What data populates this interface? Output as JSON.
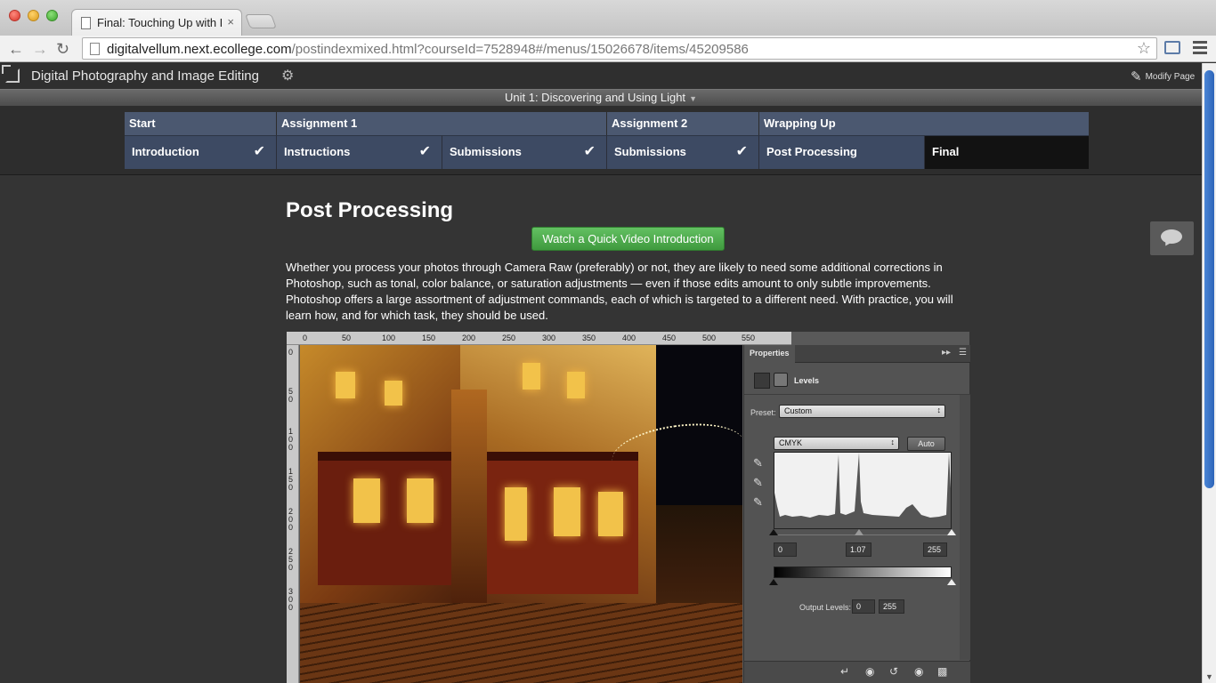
{
  "browser": {
    "tab_title": "Final: Touching Up with Le",
    "tab_close": "×",
    "url_host": "digitalvellum.next.ecollege.com",
    "url_path": "/postindexmixed.html?courseId=7528948#/menus/15026678/items/45209586"
  },
  "header": {
    "course_title": "Digital Photography and Image Editing",
    "modify_label": "Modify Page",
    "unit_title": "Unit 1: Discovering and Using Light"
  },
  "progress": {
    "phases": [
      {
        "label": "Start"
      },
      {
        "label": "Assignment 1"
      },
      {
        "label": "Assignment 2"
      },
      {
        "label": "Wrapping Up"
      }
    ],
    "steps": [
      {
        "label": "Introduction",
        "completed": true
      },
      {
        "label": "Instructions",
        "completed": true
      },
      {
        "label": "Submissions",
        "completed": true
      },
      {
        "label": "Submissions",
        "completed": true
      },
      {
        "label": "Post Processing",
        "completed": false
      },
      {
        "label": "Final",
        "completed": false,
        "active": true
      }
    ]
  },
  "content": {
    "title": "Post Processing",
    "video_button": "Watch a Quick Video Introduction",
    "body": "Whether you process your photos through Camera Raw (preferably) or not, they are likely to need some additional corrections in Photoshop, such as tonal, color balance, or saturation adjustments — even if those edits amount to only subtle improvements. Photoshop offers a large assortment of adjustment commands, each of which is targeted to a different need. With practice, you will learn how, and for which task, they should be used."
  },
  "photoshop": {
    "ruler_top": [
      "0",
      "50",
      "100",
      "150",
      "200",
      "250",
      "300",
      "350",
      "400",
      "450",
      "500",
      "550"
    ],
    "ruler_left": [
      "0",
      "50",
      "100",
      "150",
      "200",
      "250",
      "300"
    ],
    "panel_tab": "Properties",
    "adjustment_title": "Levels",
    "preset_label": "Preset:",
    "preset_value": "Custom",
    "channel_value": "CMYK",
    "auto_label": "Auto",
    "input_black": "0",
    "input_gamma": "1.07",
    "input_white": "255",
    "output_label": "Output Levels:",
    "output_black": "0",
    "output_white": "255"
  },
  "colors": {
    "phase_bg": "#4b5870",
    "step_bg": "#3d4a63",
    "active_step_bg": "#121212",
    "video_button": "#4eaa4d",
    "page_bg": "#343434"
  }
}
